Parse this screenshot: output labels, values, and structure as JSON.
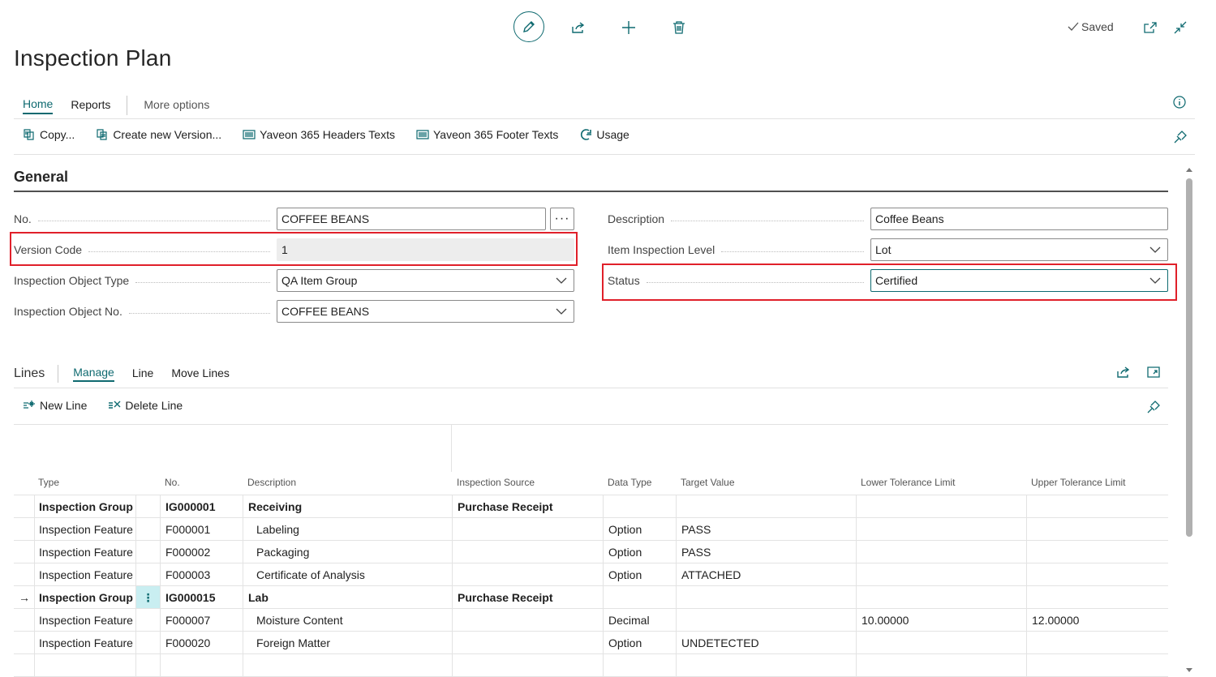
{
  "header": {
    "saved_label": "Saved",
    "icons": [
      "edit-icon",
      "share-icon",
      "add-icon",
      "delete-icon",
      "open-new-window-icon",
      "collapse-icon",
      "info-icon"
    ]
  },
  "page": {
    "title": "Inspection Plan"
  },
  "tabs": {
    "home": "Home",
    "reports": "Reports",
    "more": "More options"
  },
  "actions": {
    "copy": "Copy...",
    "create_version": "Create new Version...",
    "headers_texts": "Yaveon 365 Headers Texts",
    "footer_texts": "Yaveon 365 Footer Texts",
    "usage": "Usage"
  },
  "general": {
    "title": "General",
    "no_label": "No.",
    "no_value": "COFFEE BEANS",
    "version_label": "Version Code",
    "version_value": "1",
    "obj_type_label": "Inspection Object Type",
    "obj_type_value": "QA Item Group",
    "obj_no_label": "Inspection Object No.",
    "obj_no_value": "COFFEE BEANS",
    "desc_label": "Description",
    "desc_value": "Coffee Beans",
    "level_label": "Item Inspection Level",
    "level_value": "Lot",
    "status_label": "Status",
    "status_value": "Certified",
    "assist_label": "···"
  },
  "lines": {
    "title": "Lines",
    "tab_manage": "Manage",
    "tab_line": "Line",
    "tab_move": "Move Lines",
    "new_line": "New Line",
    "delete_line": "Delete Line",
    "columns": {
      "type": "Type",
      "no": "No.",
      "description": "Description",
      "source": "Inspection Source",
      "data_type": "Data Type",
      "target": "Target Value",
      "lower": "Lower Tolerance Limit",
      "upper": "Upper Tolerance Limit"
    },
    "rows": [
      {
        "type": "Inspection Group",
        "no": "IG000001",
        "description": "Receiving",
        "source": "Purchase Receipt",
        "data_type": "",
        "target": "",
        "lower": "",
        "upper": ""
      },
      {
        "type": "Inspection Feature",
        "no": "F000001",
        "description": "Labeling",
        "source": "",
        "data_type": "Option",
        "target": "PASS",
        "lower": "",
        "upper": ""
      },
      {
        "type": "Inspection Feature",
        "no": "F000002",
        "description": "Packaging",
        "source": "",
        "data_type": "Option",
        "target": "PASS",
        "lower": "",
        "upper": ""
      },
      {
        "type": "Inspection Feature",
        "no": "F000003",
        "description": "Certificate of Analysis",
        "source": "",
        "data_type": "Option",
        "target": "ATTACHED",
        "lower": "",
        "upper": ""
      },
      {
        "type": "Inspection Group",
        "no": "IG000015",
        "description": "Lab",
        "source": "Purchase Receipt",
        "data_type": "",
        "target": "",
        "lower": "",
        "upper": ""
      },
      {
        "type": "Inspection Feature",
        "no": "F000007",
        "description": "Moisture Content",
        "source": "",
        "data_type": "Decimal",
        "target": "",
        "lower": "10.00000",
        "upper": "12.00000"
      },
      {
        "type": "Inspection Feature",
        "no": "F000020",
        "description": "Foreign Matter",
        "source": "",
        "data_type": "Option",
        "target": "UNDETECTED",
        "lower": "",
        "upper": ""
      }
    ],
    "row_menu_glyph": "⋮",
    "current_row_glyph": "→"
  },
  "colors": {
    "accent": "#0f6a70",
    "highlight_box": "#e0202a",
    "selected_cell": "#c9eef1"
  }
}
